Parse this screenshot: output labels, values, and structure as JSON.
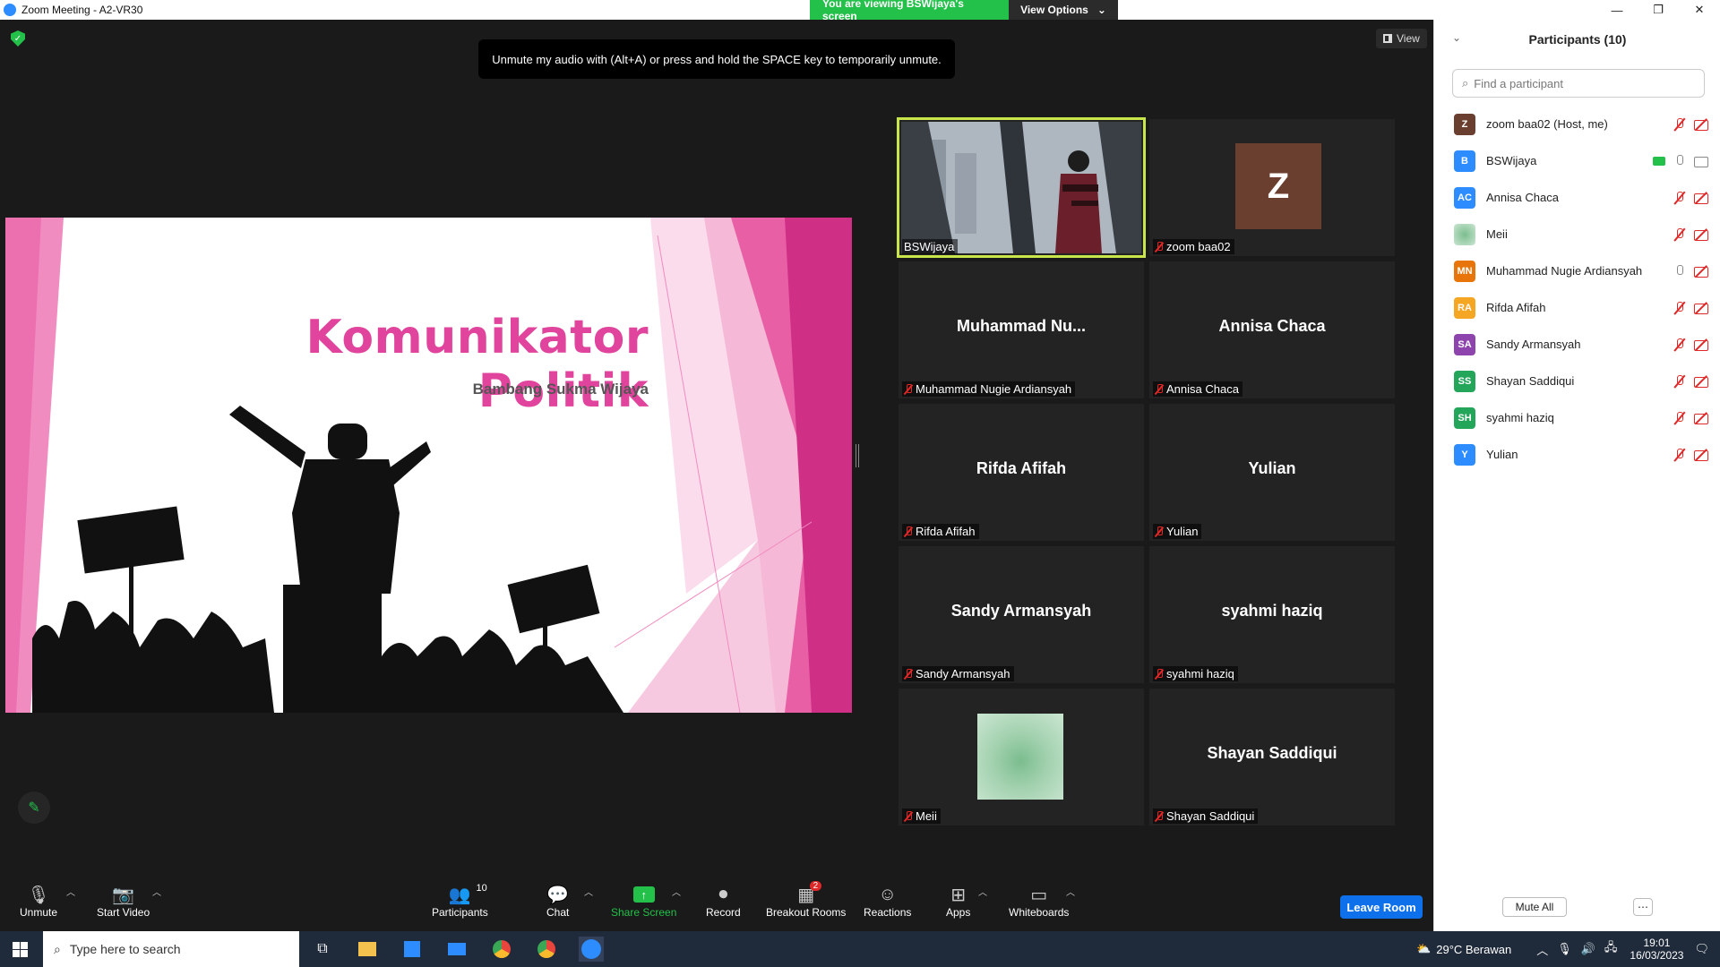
{
  "window": {
    "title": "Zoom Meeting - A2-VR30",
    "controls": [
      "—",
      "❐",
      "✕"
    ]
  },
  "share_banner": {
    "viewing": "You are viewing BSWijaya's screen",
    "view_options": "View Options",
    "chevron": "⌄"
  },
  "meeting": {
    "view_label": "View",
    "toast": "Unmute my audio with (Alt+A) or press and hold the SPACE key to temporarily unmute.",
    "slide": {
      "title": "Komunikator Politik",
      "subtitle": "Bambang Sukma Wijaya"
    }
  },
  "gallery": [
    {
      "name": "BSWijaya",
      "kind": "video",
      "active": true,
      "muted": false
    },
    {
      "name": "zoom baa02",
      "kind": "avatar",
      "avatar_letter": "Z",
      "muted": true
    },
    {
      "name": "Muhammad Nugie Ardiansyah",
      "big": "Muhammad  Nu...",
      "muted": true
    },
    {
      "name": "Annisa Chaca",
      "big": "Annisa Chaca",
      "muted": true
    },
    {
      "name": "Rifda Afifah",
      "big": "Rifda Afifah",
      "muted": true
    },
    {
      "name": "Yulian",
      "big": "Yulian",
      "muted": true
    },
    {
      "name": "Sandy Armansyah",
      "big": "Sandy Armansyah",
      "muted": true
    },
    {
      "name": "syahmi haziq",
      "big": "syahmi haziq",
      "muted": true
    },
    {
      "name": "Meii",
      "kind": "image",
      "muted": true
    },
    {
      "name": "Shayan Saddiqui",
      "big": "Shayan Saddiqui",
      "muted": true
    }
  ],
  "toolbar": {
    "unmute": "Unmute",
    "start_video": "Start Video",
    "participants": "Participants",
    "participants_count": "10",
    "chat": "Chat",
    "share_screen": "Share Screen",
    "record": "Record",
    "breakout_rooms": "Breakout Rooms",
    "breakout_badge": "2",
    "reactions": "Reactions",
    "apps": "Apps",
    "whiteboards": "Whiteboards",
    "leave_room": "Leave Room"
  },
  "participants_panel": {
    "title": "Participants (10)",
    "search_placeholder": "Find a participant",
    "mute_all": "Mute All",
    "more": "⋯",
    "list": [
      {
        "initials": "Z",
        "name": "zoom baa02 (Host, me)",
        "color": "#6b3f2f",
        "mic": "off",
        "cam": "off"
      },
      {
        "initials": "B",
        "name": "BSWijaya",
        "color": "#2d8cff",
        "mic": "on",
        "cam": "on",
        "share": true
      },
      {
        "initials": "AC",
        "name": "Annisa Chaca",
        "color": "#2d8cff",
        "mic": "off",
        "cam": "off"
      },
      {
        "initials": "",
        "name": "Meii",
        "color": "#9fd0ad",
        "mic": "off",
        "cam": "off"
      },
      {
        "initials": "MN",
        "name": "Muhammad Nugie Ardiansyah",
        "color": "#e8750a",
        "mic": "on",
        "cam": "off"
      },
      {
        "initials": "RA",
        "name": "Rifda Afifah",
        "color": "#f5a623",
        "mic": "off",
        "cam": "off"
      },
      {
        "initials": "SA",
        "name": "Sandy Armansyah",
        "color": "#8e44ad",
        "mic": "off",
        "cam": "off"
      },
      {
        "initials": "SS",
        "name": "Shayan Saddiqui",
        "color": "#23a55a",
        "mic": "off",
        "cam": "off"
      },
      {
        "initials": "SH",
        "name": "syahmi haziq",
        "color": "#23a55a",
        "mic": "off",
        "cam": "off"
      },
      {
        "initials": "Y",
        "name": "Yulian",
        "color": "#2d8cff",
        "mic": "off",
        "cam": "off"
      }
    ]
  },
  "taskbar": {
    "search_placeholder": "Type here to search",
    "weather": "29°C  Berawan",
    "time": "19:01",
    "date": "16/03/2023"
  },
  "colors": {
    "accent_green": "#23c04a",
    "leave_blue": "#0e71eb",
    "slide_pink": "#e0449c",
    "active_outline": "#c8e64a"
  }
}
